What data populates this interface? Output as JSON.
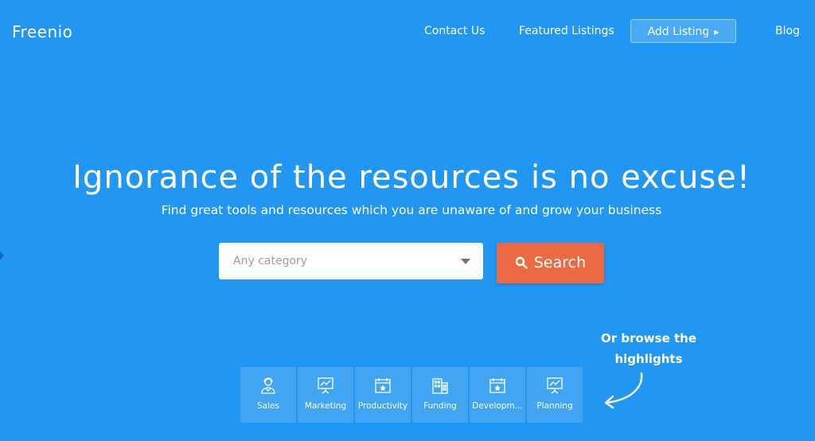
{
  "brand": {
    "logo": "Freenio"
  },
  "nav": {
    "contact_us": "Contact Us",
    "featured_listings": "Featured Listings",
    "add_listing": "Add Listing",
    "blog": "Blog"
  },
  "hero": {
    "title": "Ignorance of the resources is no excuse!",
    "subtitle": "Find great tools and resources which you are unaware of and grow your business"
  },
  "search": {
    "category_placeholder": "Any category",
    "button_label": "Search"
  },
  "browse": {
    "line1": "Or browse the",
    "line2": "highlights"
  },
  "categories": [
    {
      "label": "Sales",
      "icon": "support-agent-icon"
    },
    {
      "label": "Marketing",
      "icon": "presentation-chart-icon"
    },
    {
      "label": "Productivity",
      "icon": "calendar-star-icon"
    },
    {
      "label": "Funding",
      "icon": "building-icon"
    },
    {
      "label": "Developm...",
      "icon": "calendar-star-icon"
    },
    {
      "label": "Planning",
      "icon": "presentation-chart-icon"
    }
  ],
  "colors": {
    "background": "#2196f3",
    "search_button": "#ec6a43"
  }
}
